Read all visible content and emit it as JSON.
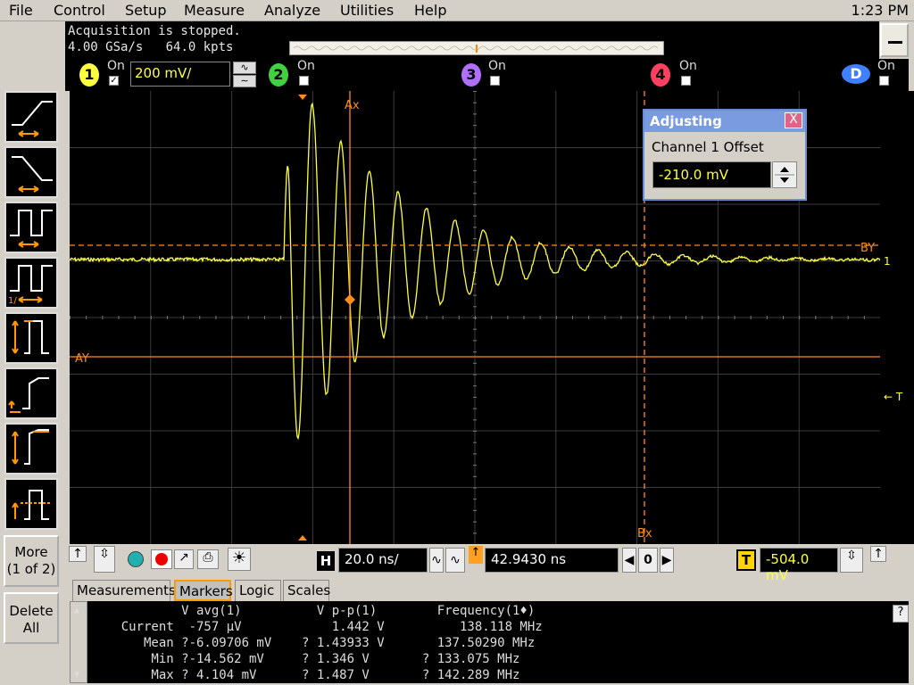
{
  "menu": {
    "items": [
      "File",
      "Control",
      "Setup",
      "Measure",
      "Analyze",
      "Utilities",
      "Help"
    ],
    "clock": "1:23 PM"
  },
  "status": {
    "line1": "Acquisition is stopped.",
    "sample_rate": "4.00 GSa/s",
    "memory": "64.0 kpts"
  },
  "channels": [
    {
      "num": "1",
      "on_label": "On",
      "checked": true,
      "color": "#ffff40",
      "scale": "200 mV/"
    },
    {
      "num": "2",
      "on_label": "On",
      "checked": false,
      "color": "#40d040"
    },
    {
      "num": "3",
      "on_label": "On",
      "checked": false,
      "color": "#b070ff"
    },
    {
      "num": "4",
      "on_label": "On",
      "checked": false,
      "color": "#ff4060"
    },
    {
      "num": "D",
      "on_label": "On",
      "checked": false,
      "color": "#4080ff"
    }
  ],
  "left": {
    "more_label": "More",
    "more_sub": "(1 of 2)",
    "delete_label": "Delete",
    "delete_sub": "All"
  },
  "graticule": {
    "markers": {
      "ax": "Ax",
      "bx": "Bx",
      "ay": "AY",
      "by": "BY"
    },
    "ground_label": "1",
    "trigger_label": "T"
  },
  "waveform": {
    "baseline_y": 0.372,
    "ringing_freq_note": "damped sine"
  },
  "dialog": {
    "title": "Adjusting",
    "close": "X",
    "label": "Channel 1 Offset",
    "value": "-210.0 mV"
  },
  "controls": {
    "h_label": "H",
    "timebase": "20.0 ns/",
    "delay": "42.9430 ns",
    "zero": "0",
    "t_label": "T",
    "trigger_level": "-504.0 mV"
  },
  "tabs": [
    "Measurements",
    "Markers",
    "Logic",
    "Scales"
  ],
  "active_tab": 1,
  "measurements": {
    "header": "            V avg(1)          V p-p(1)        Frequency(1♦)",
    "rows": [
      "    Current  -757 µV            1.442 V          138.118 MHz",
      "       Mean ?-6.09706 mV    ? 1.43933 V       137.50290 MHz",
      "        Min ?-14.562 mV     ? 1.346 V       ? 133.075 MHz",
      "        Max ? 4.104 mV      ? 1.487 V       ? 142.289 MHz"
    ],
    "help": "?"
  }
}
